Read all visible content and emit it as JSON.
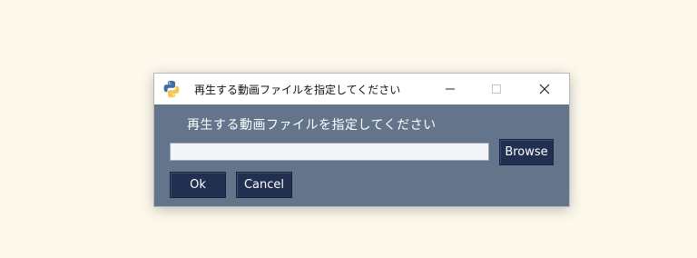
{
  "window": {
    "title": "再生する動画ファイルを指定してください"
  },
  "dialog": {
    "prompt": "再生する動画ファイルを指定してください",
    "file_path": {
      "value": "",
      "placeholder": ""
    },
    "browse_label": "Browse",
    "ok_label": "Ok",
    "cancel_label": "Cancel"
  },
  "icons": {
    "app": "python-icon",
    "minimize": "minimize-icon",
    "maximize": "maximize-icon",
    "close": "close-icon"
  },
  "colors": {
    "background": "#fdf8ec",
    "dialog_body": "#64748b",
    "button": "#213050",
    "input": "#f3f4f8"
  }
}
